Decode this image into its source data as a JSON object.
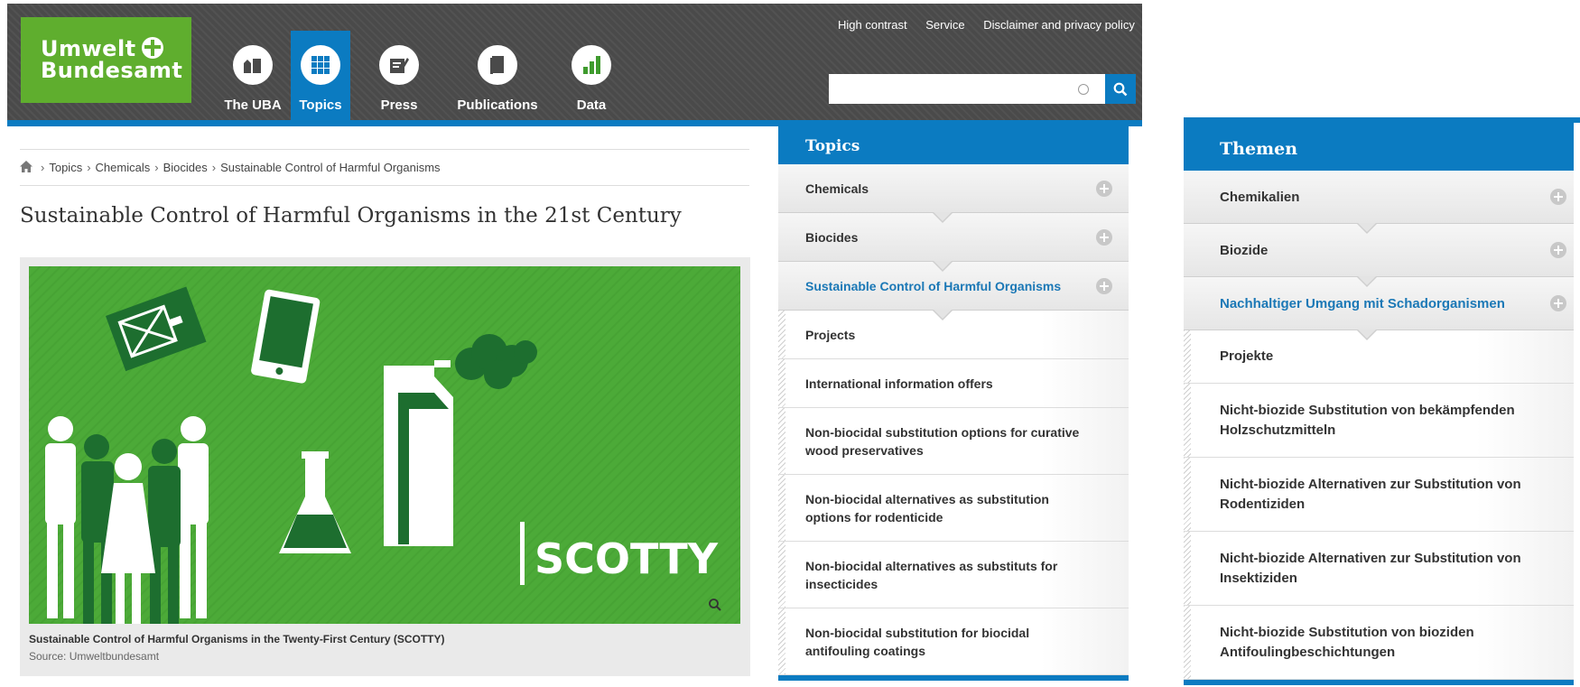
{
  "header": {
    "logo_line1": "Umwelt",
    "logo_line2": "Bundesamt",
    "nav": [
      {
        "label": "The UBA",
        "icon": "building-icon"
      },
      {
        "label": "Topics",
        "icon": "grid-icon",
        "active": true
      },
      {
        "label": "Press",
        "icon": "notepad-icon"
      },
      {
        "label": "Publications",
        "icon": "book-icon"
      },
      {
        "label": "Data",
        "icon": "bar-chart-icon"
      }
    ],
    "util_links": [
      "High contrast",
      "Service",
      "Disclaimer and privacy policy"
    ],
    "search": {
      "placeholder": "",
      "value": ""
    }
  },
  "breadcrumb": [
    "Topics",
    "Chemicals",
    "Biocides",
    "Sustainable Control of Harmful Organisms"
  ],
  "page_title": "Sustainable Control of Harmful Organisms in the 21st Century",
  "figure": {
    "overlay_text": "SCOTTY",
    "caption": "Sustainable Control of Harmful Organisms in the Twenty-First Century (SCOTTY)",
    "source": "Source: Umweltbundesamt"
  },
  "topics_panel_en": {
    "heading": "Topics",
    "accordion": [
      {
        "label": "Chemicals"
      },
      {
        "label": "Biocides"
      },
      {
        "label": "Sustainable Control of Harmful Organisms",
        "current": true
      }
    ],
    "items": [
      "Projects",
      "International information offers",
      "Non-biocidal substitution options for curative wood preservatives",
      "Non-biocidal alternatives as substitution options for rodenticide",
      "Non-biocidal alternatives as substituts for insecticides",
      "Non-biocidal substitution for biocidal antifouling coatings"
    ]
  },
  "topics_panel_de": {
    "heading": "Themen",
    "accordion": [
      {
        "label": "Chemikalien"
      },
      {
        "label": "Biozide"
      },
      {
        "label": "Nachhaltiger Umgang mit Schadorganismen",
        "current": true
      }
    ],
    "items": [
      "Projekte",
      "Nicht-biozide Substitution von bekämpfenden Holzschutzmitteln",
      "Nicht-biozide Alternativen zur Substitution von Rodentiziden",
      "Nicht-biozide Alternativen zur Substitution von Insektiziden",
      "Nicht-biozide Substitution von bioziden Antifoulingbeschichtungen"
    ]
  },
  "colors": {
    "brand_green": "#5fae2e",
    "brand_blue": "#0b7bc1",
    "header_gray": "#4a4a4a",
    "figure_green": "#4caa38",
    "current_link": "#1b78b6"
  }
}
